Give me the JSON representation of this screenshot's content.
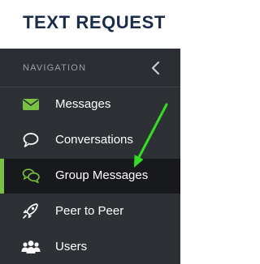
{
  "logo": {
    "text": "TEXT REQUEST"
  },
  "nav": {
    "header": "NAVIGATION",
    "collapse_icon": "chevron-left-icon",
    "items": [
      {
        "label": "Messages",
        "icon": "envelope-icon",
        "active": false
      },
      {
        "label": "Conversations",
        "icon": "chat-bubble-icon",
        "active": false
      },
      {
        "label": "Group Messages",
        "icon": "group-chat-icon",
        "active": true
      },
      {
        "label": "Peer to Peer",
        "icon": "rocket-icon",
        "active": false
      },
      {
        "label": "Users",
        "icon": "users-icon",
        "active": false
      }
    ]
  },
  "colors": {
    "brand_navy": "#1b2c4a",
    "accent_green": "#7ac143",
    "sidebar_bg": "#2d3135",
    "active_bg": "#17191c",
    "annotation_arrow": "#33dd22"
  }
}
